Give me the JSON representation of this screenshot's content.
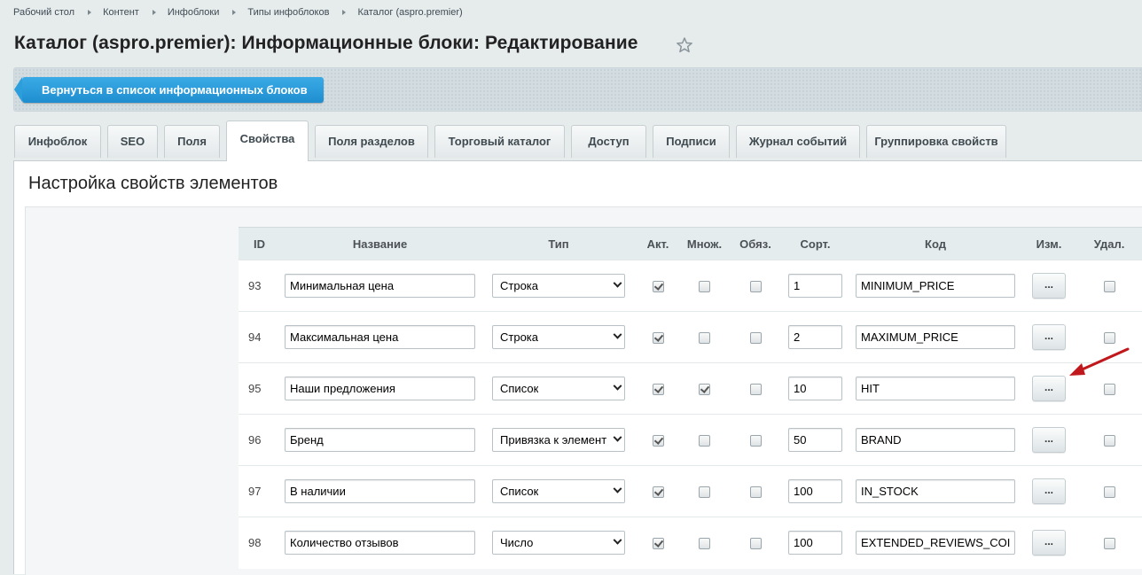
{
  "breadcrumbs": [
    "Рабочий стол",
    "Контент",
    "Инфоблоки",
    "Типы инфоблоков",
    "Каталог (aspro.premier)"
  ],
  "page_title": "Каталог (aspro.premier): Информационные блоки: Редактирование",
  "favorite_icon": "star-outline-icon",
  "back_button_label": "Вернуться в список информационных блоков",
  "tabs": [
    {
      "label": "Инфоблок",
      "active": false
    },
    {
      "label": "SEO",
      "active": false
    },
    {
      "label": "Поля",
      "active": false
    },
    {
      "label": "Свойства",
      "active": true
    },
    {
      "label": "Поля разделов",
      "active": false
    },
    {
      "label": "Торговый каталог",
      "active": false
    },
    {
      "label": "Доступ",
      "active": false
    },
    {
      "label": "Подписи",
      "active": false
    },
    {
      "label": "Журнал событий",
      "active": false
    },
    {
      "label": "Группировка свойств",
      "active": false
    }
  ],
  "section_title": "Настройка свойств элементов",
  "table": {
    "columns": [
      "ID",
      "Название",
      "Тип",
      "Акт.",
      "Множ.",
      "Обяз.",
      "Сорт.",
      "Код",
      "Изм.",
      "Удал."
    ],
    "rows": [
      {
        "id": "93",
        "name": "Минимальная цена",
        "type": "Строка",
        "active": true,
        "multiple": false,
        "required": false,
        "sort": "1",
        "code": "MINIMUM_PRICE",
        "edit": "...",
        "delete": false
      },
      {
        "id": "94",
        "name": "Максимальная цена",
        "type": "Строка",
        "active": true,
        "multiple": false,
        "required": false,
        "sort": "2",
        "code": "MAXIMUM_PRICE",
        "edit": "...",
        "delete": false
      },
      {
        "id": "95",
        "name": "Наши предложения",
        "type": "Список",
        "active": true,
        "multiple": true,
        "required": false,
        "sort": "10",
        "code": "HIT",
        "edit": "...",
        "delete": false
      },
      {
        "id": "96",
        "name": "Бренд",
        "type": "Привязка к элемент",
        "active": true,
        "multiple": false,
        "required": false,
        "sort": "50",
        "code": "BRAND",
        "edit": "...",
        "delete": false
      },
      {
        "id": "97",
        "name": "В наличии",
        "type": "Список",
        "active": true,
        "multiple": false,
        "required": false,
        "sort": "100",
        "code": "IN_STOCK",
        "edit": "...",
        "delete": false
      },
      {
        "id": "98",
        "name": "Количество отзывов",
        "type": "Число",
        "active": true,
        "multiple": false,
        "required": false,
        "sort": "100",
        "code": "EXTENDED_REVIEWS_COI",
        "edit": "...",
        "delete": false
      }
    ]
  },
  "annotation_arrow_color": "#c0181c",
  "colors": {
    "accent": "#2196d6",
    "background": "#e6ebec"
  }
}
